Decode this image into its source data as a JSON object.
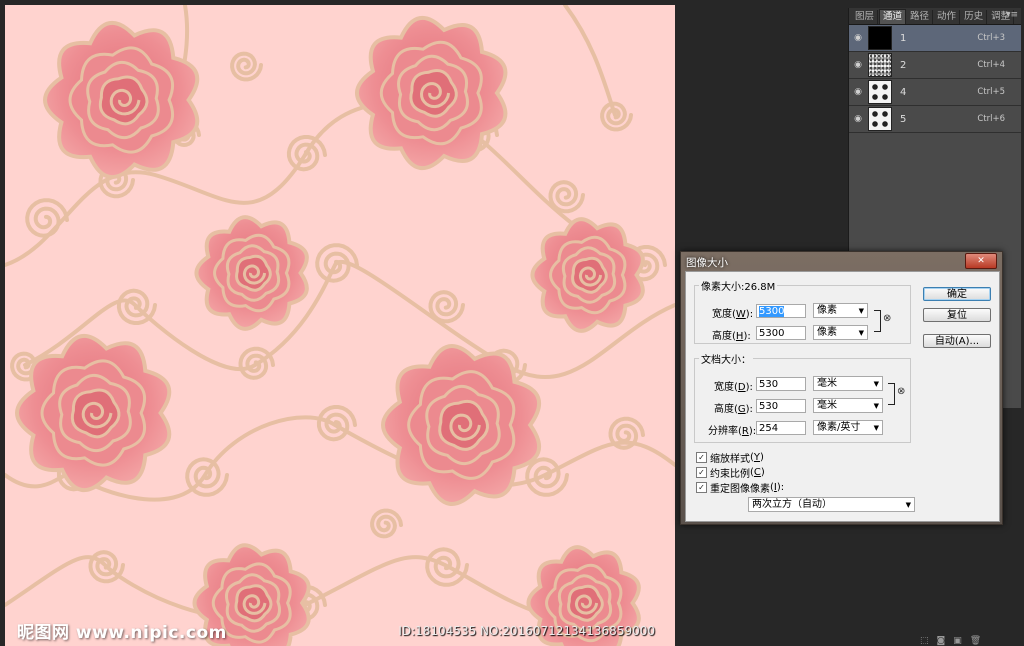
{
  "watermark": {
    "text": "昵图网 www.nipic.com"
  },
  "image_id": {
    "text": "ID:18104535 NO:20160712134136859000"
  },
  "channels_panel": {
    "tabs": [
      {
        "label": "图层"
      },
      {
        "label": "通道"
      },
      {
        "label": "路径"
      },
      {
        "label": "动作"
      },
      {
        "label": "历史"
      },
      {
        "label": "调整"
      }
    ],
    "active_tab": "通道",
    "channels": [
      {
        "name": "1",
        "shortcut": "Ctrl+3",
        "thumb": "black"
      },
      {
        "name": "2",
        "shortcut": "Ctrl+4",
        "thumb": "noise"
      },
      {
        "name": "4",
        "shortcut": "Ctrl+5",
        "thumb": "roses"
      },
      {
        "name": "5",
        "shortcut": "Ctrl+6",
        "thumb": "roses"
      }
    ]
  },
  "dialog": {
    "title": "图像大小",
    "pixel_dimensions": {
      "legend": "像素大小:26.8M",
      "width_label": "宽度",
      "width_key": "W",
      "width_value": "5300",
      "width_unit": "像素",
      "height_label": "高度",
      "height_key": "H",
      "height_value": "5300",
      "height_unit": "像素"
    },
    "document_size": {
      "legend": "文档大小：",
      "width_label": "宽度",
      "width_key": "D",
      "width_value": "530",
      "width_unit": "毫米",
      "height_label": "高度",
      "height_key": "G",
      "height_value": "530",
      "height_unit": "毫米",
      "resolution_label": "分辨率",
      "resolution_key": "R",
      "resolution_value": "254",
      "resolution_unit": "像素/英寸"
    },
    "buttons": {
      "ok": "确定",
      "reset": "复位",
      "auto": "自动(A)..."
    },
    "checkboxes": [
      {
        "label": "缩放样式",
        "key": "Y",
        "checked": true
      },
      {
        "label": "约束比例",
        "key": "C",
        "checked": true
      },
      {
        "label": "重定图像像素",
        "key": "I",
        "checked": true
      }
    ],
    "resample_method": "两次立方（自动）"
  },
  "colors": {
    "canvas_bg": "#ffd3cf",
    "rose_fill": "#ec8a8f",
    "rose_dark": "#e06f78",
    "vine": "#e7bfa3",
    "panel_bg": "#4a4a4a",
    "selected_row": "#5d6779"
  }
}
